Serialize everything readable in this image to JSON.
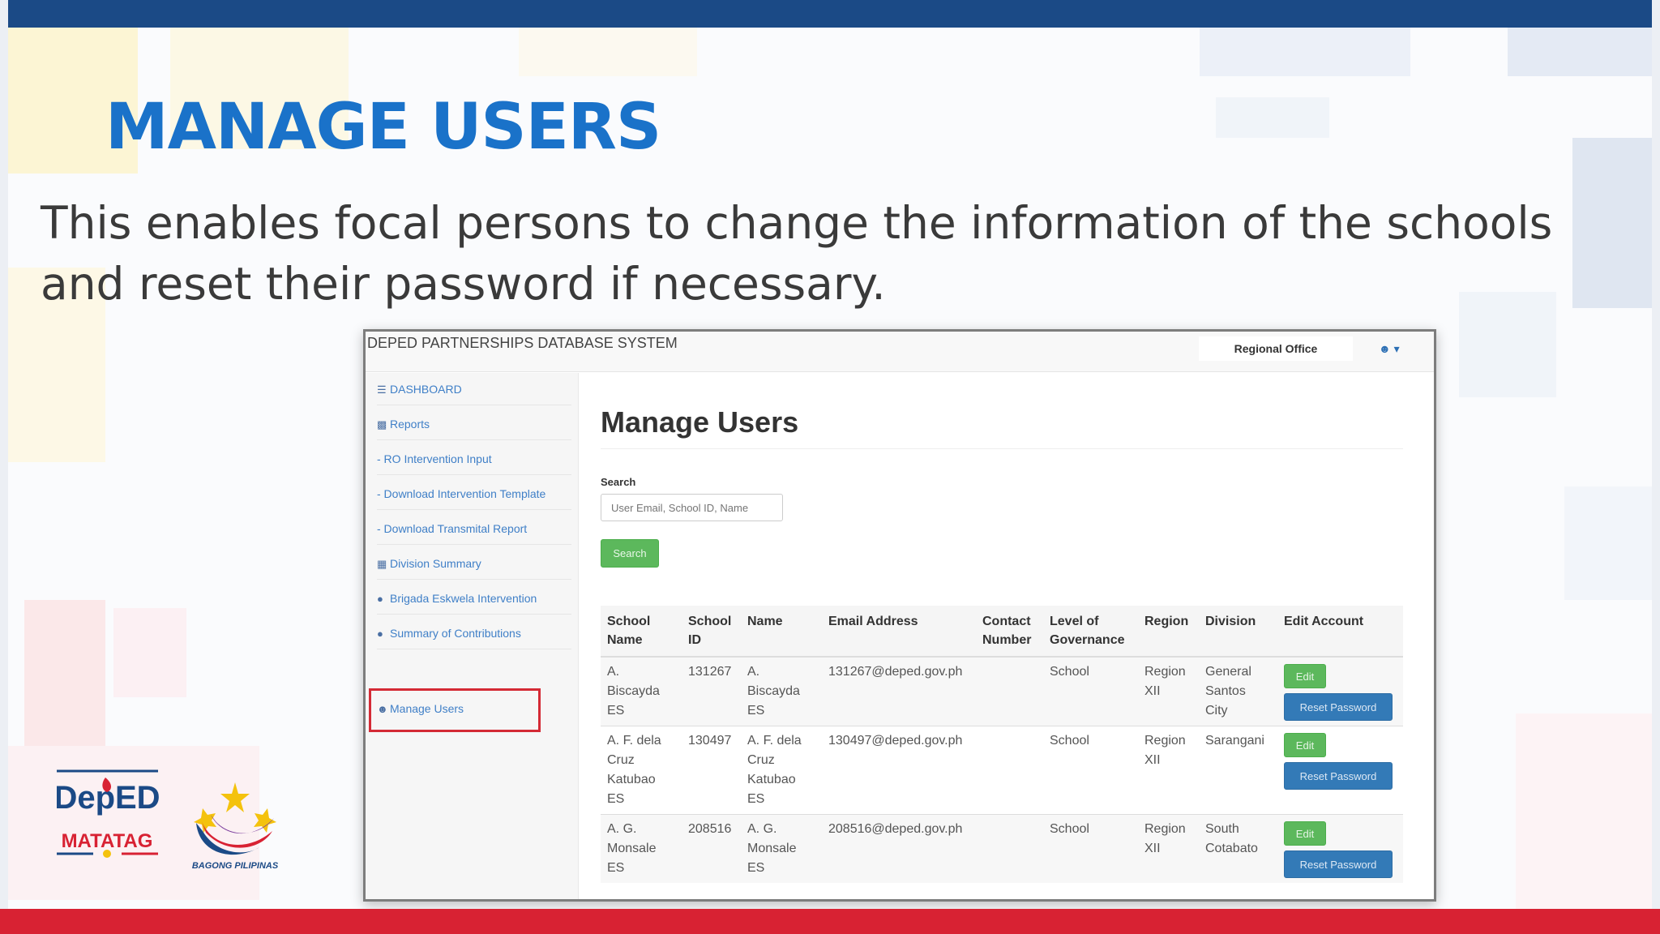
{
  "slide": {
    "title": "MANAGE USERS",
    "description": "This enables focal persons to change the information of the schools and reset their password if necessary.",
    "logos": {
      "deped_top": "DepED",
      "deped_bottom": "MATATAG",
      "bagong": "BAGONG PILIPINAS"
    },
    "colors": {
      "top_bar": "#1b4a86",
      "bottom_bar": "#d82233",
      "title": "#1a72c9",
      "highlight": "#d42a35"
    }
  },
  "app": {
    "brand": "DEPED PARTNERSHIPS DATABASE SYSTEM",
    "office": "Regional Office",
    "user_menu_icon": "user-icon",
    "sidebar": [
      {
        "icon": "list-icon",
        "label": "DASHBOARD"
      },
      {
        "icon": "bar-chart-icon",
        "label": "Reports"
      },
      {
        "icon": "",
        "label": "- RO Intervention Input"
      },
      {
        "icon": "",
        "label": "- Download Intervention Template"
      },
      {
        "icon": "",
        "label": "- Download Transmital Report"
      },
      {
        "icon": "book-icon",
        "label": "Division Summary"
      },
      {
        "icon": "group-icon",
        "label": "Brigada Eskwela Intervention"
      },
      {
        "icon": "group-icon",
        "label": "Summary of Contributions"
      },
      {
        "icon": "user-icon",
        "label": "Manage Users",
        "highlighted": true
      }
    ],
    "main": {
      "heading": "Manage Users",
      "search": {
        "label": "Search",
        "placeholder": "User Email, School ID, Name",
        "button": "Search"
      },
      "table": {
        "columns": [
          "School Name",
          "School ID",
          "Name",
          "Email Address",
          "Contact Number",
          "Level of Governance",
          "Region",
          "Division",
          "Edit Account"
        ],
        "rows": [
          {
            "school_name": "A. Biscayda ES",
            "school_id": "131267",
            "name": "A. Biscayda ES",
            "email": "131267@deped.gov.ph",
            "contact": "",
            "level": "School",
            "region": "Region XII",
            "division": "General Santos City",
            "edit": "Edit",
            "reset": "Reset Password"
          },
          {
            "school_name": "A. F. dela Cruz Katubao ES",
            "school_id": "130497",
            "name": "A. F. dela Cruz Katubao ES",
            "email": "130497@deped.gov.ph",
            "contact": "",
            "level": "School",
            "region": "Region XII",
            "division": "Sarangani",
            "edit": "Edit",
            "reset": "Reset Password"
          },
          {
            "school_name": "A. G. Monsale ES",
            "school_id": "208516",
            "name": "A. G. Monsale ES",
            "email": "208516@deped.gov.ph",
            "contact": "",
            "level": "School",
            "region": "Region XII",
            "division": "South Cotabato",
            "edit": "Edit",
            "reset": "Reset Password"
          }
        ]
      }
    }
  }
}
